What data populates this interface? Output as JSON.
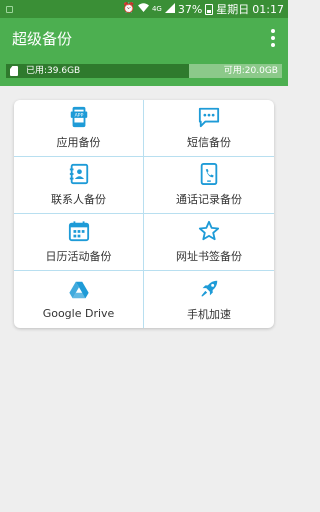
{
  "status_bar": {
    "battery": "37%",
    "network": "4G",
    "day": "星期日",
    "time": "01:17"
  },
  "app_bar": {
    "title": "超级备份"
  },
  "storage": {
    "used_label": "已用:39.6GB",
    "free_label": "可用:20.0GB",
    "used_gb": 39.6,
    "free_gb": 20.0
  },
  "menu": {
    "items": [
      {
        "label": "应用备份",
        "icon": "app-backup-icon"
      },
      {
        "label": "短信备份",
        "icon": "sms-icon"
      },
      {
        "label": "联系人备份",
        "icon": "contacts-icon"
      },
      {
        "label": "通话记录备份",
        "icon": "call-log-icon"
      },
      {
        "label": "日历活动备份",
        "icon": "calendar-icon"
      },
      {
        "label": "网址书签备份",
        "icon": "bookmark-star-icon"
      },
      {
        "label": "Google Drive",
        "icon": "google-drive-icon"
      },
      {
        "label": "手机加速",
        "icon": "rocket-icon"
      }
    ]
  },
  "colors": {
    "status_bar": "#3a8f36",
    "app_bar": "#4caf50",
    "icon_blue": "#1e9bd7",
    "divider": "#b8dff0",
    "background": "#eeeeee"
  }
}
